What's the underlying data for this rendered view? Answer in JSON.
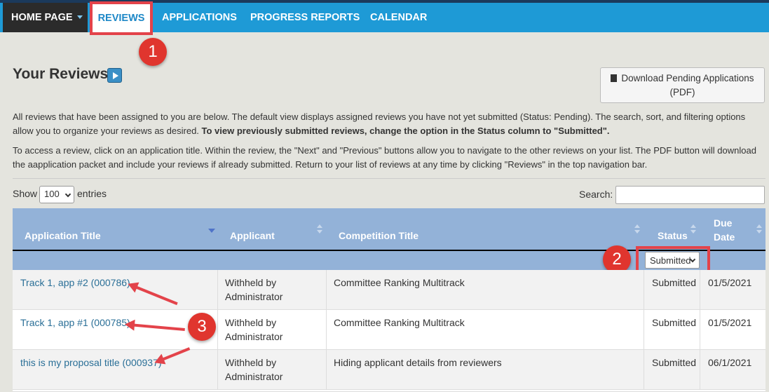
{
  "nav": {
    "home": "HOME PAGE",
    "reviews": "REVIEWS",
    "applications": "APPLICATIONS",
    "progress_reports": "PROGRESS REPORTS",
    "calendar": "CALENDAR"
  },
  "annotations": [
    "1",
    "2",
    "3"
  ],
  "page": {
    "title": "Your Reviews",
    "download_button": "Download Pending Applications (PDF)",
    "intro_text": "All reviews that have been assigned to you are below. The default view displays assigned reviews you have not yet submitted (Status: Pending). The search, sort, and filtering options allow you to organize your reviews as desired. ",
    "intro_bold": "To view previously submitted reviews, change the option in the Status column to \"Submitted\".",
    "access_text": "To access a review, click on an application title. Within the review, the \"Next\" and \"Previous\" buttons allow you to navigate to the other reviews on your list. The PDF button will download the aapplication packet and include your reviews if already submitted. Return to your list of reviews at any time by clicking \"Reviews\" in the top navigation bar."
  },
  "table_controls": {
    "show_label": "Show",
    "show_value": "100",
    "entries_label": "entries",
    "search_label": "Search:",
    "status_filter_value": "Submitted"
  },
  "table": {
    "headers": [
      "Application Title",
      "Applicant",
      "Competition Title",
      "Status",
      "Due Date"
    ],
    "rows": [
      {
        "title": "Track 1, app #2 (000786)",
        "applicant": "Withheld by Administrator",
        "competition": "Committee Ranking Multitrack",
        "status": "Submitted",
        "due": "01/5/2021"
      },
      {
        "title": "Track 1, app #1 (000785)",
        "applicant": "Withheld by Administrator",
        "competition": "Committee Ranking Multitrack",
        "status": "Submitted",
        "due": "01/5/2021"
      },
      {
        "title": "this is my proposal title (000937)",
        "applicant": "Withheld by Administrator",
        "competition": "Hiding applicant details from reviewers",
        "status": "Submitted",
        "due": "06/1/2021"
      }
    ]
  },
  "colors": {
    "navbar": "#1e9ad6",
    "highlight": "#e3434a",
    "table_header": "#93b2d8",
    "link": "#2a6f97"
  }
}
